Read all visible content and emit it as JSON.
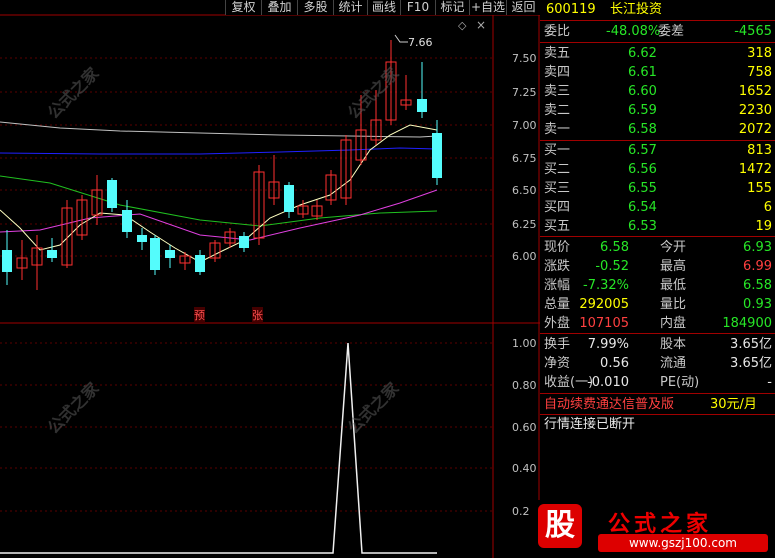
{
  "toolbar": [
    "复权",
    "叠加",
    "多股",
    "统计",
    "画线",
    "F10",
    "标记",
    "+自选",
    "返回"
  ],
  "main_chart": {
    "max_price_label": "7.66",
    "price_axis": [
      "7.50",
      "7.25",
      "7.00",
      "6.75",
      "6.50",
      "6.25",
      "6.00"
    ],
    "markers": [
      "预",
      "张"
    ]
  },
  "indicator": {
    "axis": [
      "1.00",
      "0.80",
      "0.60",
      "0.40",
      "0.2"
    ]
  },
  "quote": {
    "code": "600119",
    "name": "长江投资",
    "wei_bi_label": "委比",
    "wei_bi": "-48.08%",
    "wei_cha_label": "委差",
    "wei_cha": "-4565",
    "asks": [
      {
        "label": "卖五",
        "price": "6.62",
        "vol": "318"
      },
      {
        "label": "卖四",
        "price": "6.61",
        "vol": "758"
      },
      {
        "label": "卖三",
        "price": "6.60",
        "vol": "1652"
      },
      {
        "label": "卖二",
        "price": "6.59",
        "vol": "2230"
      },
      {
        "label": "卖一",
        "price": "6.58",
        "vol": "2072"
      }
    ],
    "bids": [
      {
        "label": "买一",
        "price": "6.57",
        "vol": "813"
      },
      {
        "label": "买二",
        "price": "6.56",
        "vol": "1472"
      },
      {
        "label": "买三",
        "price": "6.55",
        "vol": "155"
      },
      {
        "label": "买四",
        "price": "6.54",
        "vol": "6"
      },
      {
        "label": "买五",
        "price": "6.53",
        "vol": "19"
      }
    ],
    "stats": [
      {
        "l1": "现价",
        "v1": "6.58",
        "l2": "今开",
        "v2": "6.93"
      },
      {
        "l1": "涨跌",
        "v1": "-0.52",
        "l2": "最高",
        "v2": "6.99"
      },
      {
        "l1": "涨幅",
        "v1": "-7.32%",
        "l2": "最低",
        "v2": "6.58"
      },
      {
        "l1": "总量",
        "v1": "292005",
        "l2": "量比",
        "v2": "0.93"
      },
      {
        "l1": "外盘",
        "v1": "107105",
        "l2": "内盘",
        "v2": "184900"
      }
    ],
    "fin": [
      {
        "l1": "换手",
        "v1": "7.99%",
        "l2": "股本",
        "v2": "3.65亿"
      },
      {
        "l1": "净资",
        "v1": "0.56",
        "l2": "流通",
        "v2": "3.65亿"
      },
      {
        "l1": "收益(一)",
        "v1": "-0.010",
        "l2": "PE(动)",
        "v2": "-"
      }
    ],
    "promo_text": "自动续费通达信普及版",
    "promo_price": "30元/月",
    "status": "行情连接已断开"
  },
  "watermark": {
    "brand": "公式之家",
    "url": "www.gszj100.com",
    "stamp": "股",
    "site_text": "gszj100.com"
  }
}
